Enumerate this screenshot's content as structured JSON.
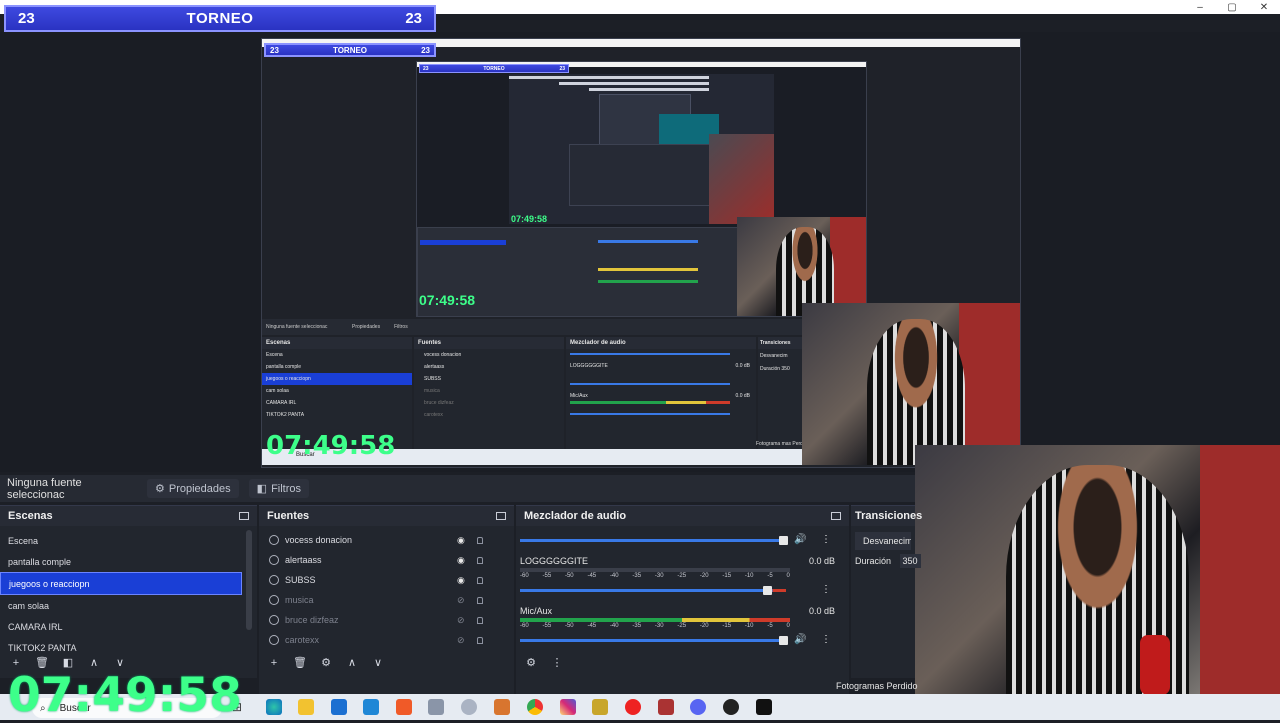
{
  "window": {
    "controls": [
      "–",
      "▢",
      "✕"
    ]
  },
  "banner": {
    "left_score": "23",
    "title": "TORNEO",
    "right_score": "23"
  },
  "source_bar": {
    "no_source": "Ninguna fuente seleccionac",
    "properties": "Propiedades",
    "filters": "Filtros"
  },
  "scenes": {
    "title": "Escenas",
    "items": [
      "Escena",
      "pantalla comple",
      "juegoos o reacciopn",
      "cam solaa",
      "CAMARA IRL",
      "TIKTOK2 PANTA"
    ],
    "selected_index": 2
  },
  "sources": {
    "title": "Fuentes",
    "items": [
      {
        "label": "vocess donacion",
        "visible": true
      },
      {
        "label": "alertaass",
        "visible": true
      },
      {
        "label": "SUBSS",
        "visible": true
      },
      {
        "label": "musica",
        "visible": false
      },
      {
        "label": "bruce dizfeaz",
        "visible": false
      },
      {
        "label": "carotexx",
        "visible": false
      }
    ]
  },
  "mixer": {
    "title": "Mezclador de audio",
    "channels": [
      {
        "name": "LOGGGGGGITE",
        "db": "0.0 dB"
      },
      {
        "name": "Mic/Aux",
        "db": "0.0 dB"
      }
    ],
    "scale": [
      "-60",
      "-55",
      "-50",
      "-45",
      "-40",
      "-35",
      "-30",
      "-25",
      "-20",
      "-15",
      "-10",
      "-5",
      "0"
    ]
  },
  "transitions": {
    "title": "Transiciones",
    "type": "Desvanecimie",
    "duration_label": "Duración",
    "duration_value": "350"
  },
  "status": {
    "frames_lost": "Fotogramas Perdido"
  },
  "clock": "07:49:58",
  "taskbar": {
    "search": "Buscar"
  },
  "nested": {
    "clock": "07:49:58",
    "no_source": "Ninguna fuente seleccionac",
    "properties": "Propiedades",
    "filters": "Filtros",
    "scenes_title": "Escenas",
    "sources_title": "Fuentes",
    "mixer_title": "Mezclador de audio",
    "transitions_title": "Transiciones",
    "scene_items": [
      "Escena",
      "pantalla comple",
      "juegoos o reacciopn",
      "cam solaa",
      "CAMARA IRL",
      "TIKTOK2 PANTA"
    ],
    "source_items": [
      "vocess donacion",
      "alertaass",
      "SUBSS",
      "musica",
      "bruce dizfeaz",
      "carotexx"
    ],
    "channel1": "LOGGGGGGITE",
    "channel2": "Mic/Aux",
    "db": "0.0 dB",
    "transition_type": "Desvanecim",
    "duration_label": "Duración",
    "duration_value": "350",
    "search": "Buscar",
    "frames_lost": "Fotograma mas Perdid"
  },
  "colors": {
    "accent": "#1a3fd6",
    "clock": "#3dff8a",
    "banner": "#3e49e0"
  }
}
